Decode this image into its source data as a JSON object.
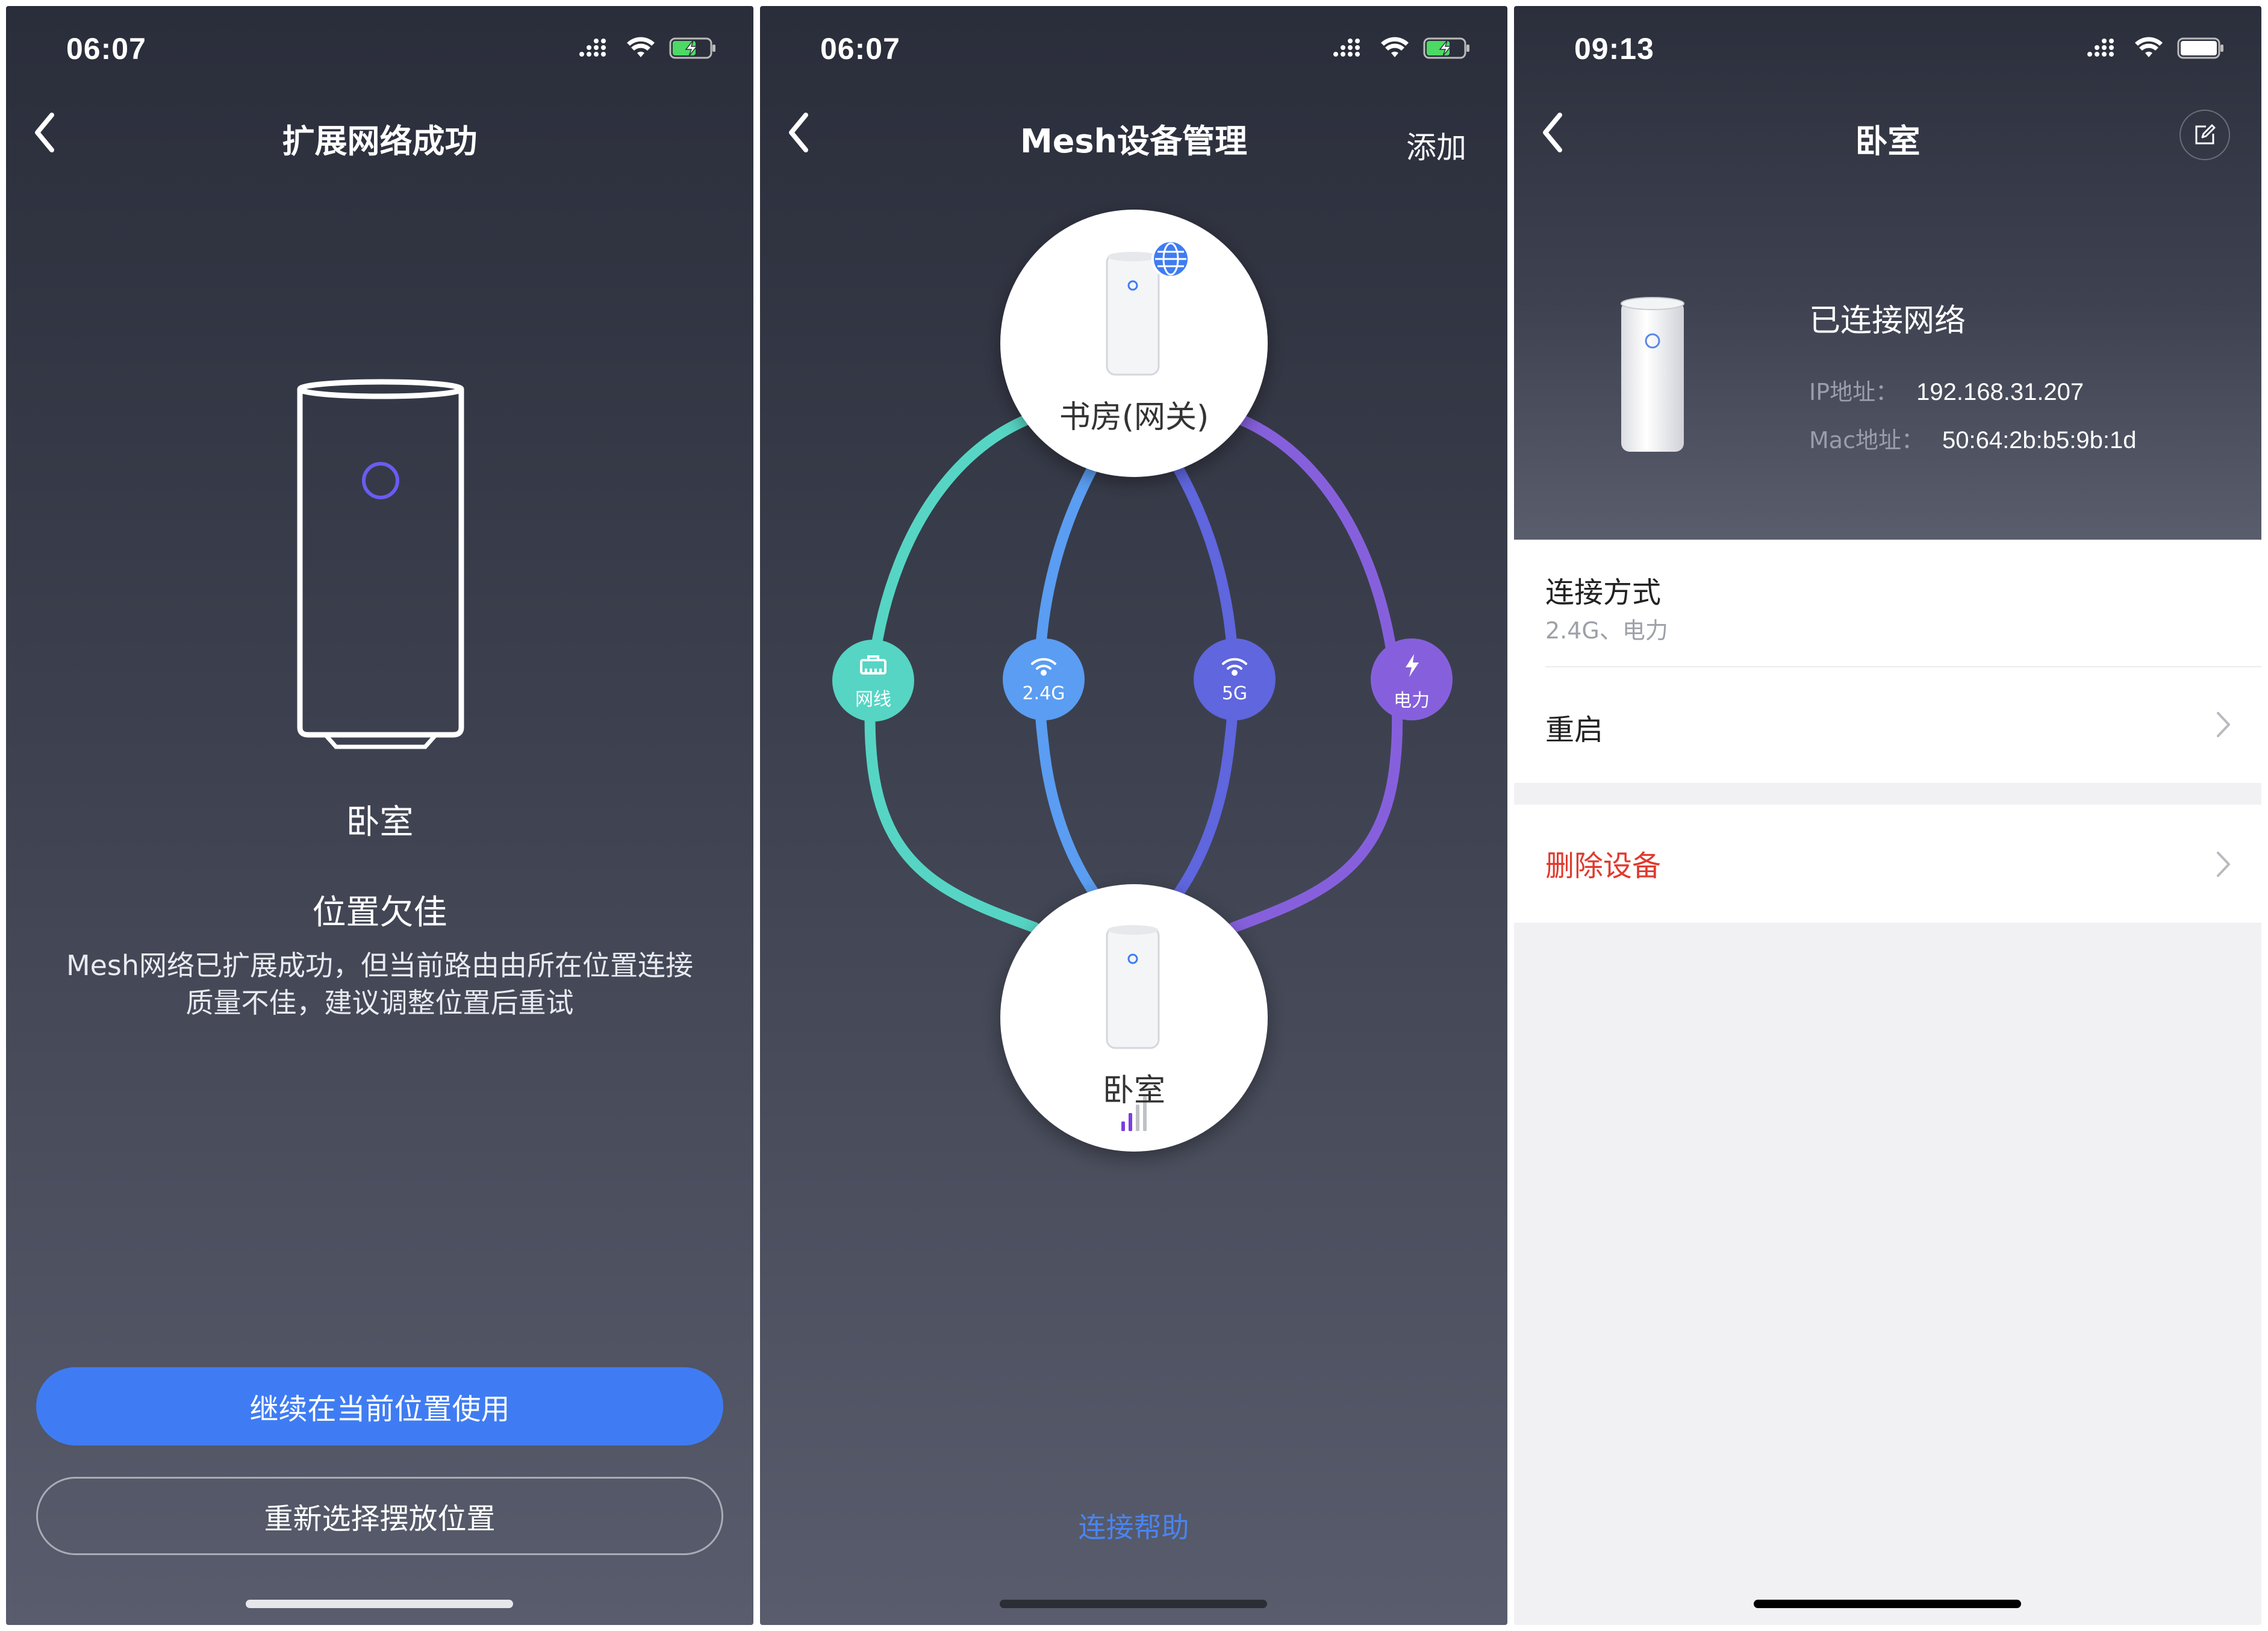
{
  "colors": {
    "primary_blue": "#3f7cf3",
    "ethernet": "#56d5c4",
    "wifi24": "#5a9df2",
    "wifi5": "#5f66de",
    "power": "#8660dc",
    "danger": "#e03a2e",
    "help_link": "#4b84f0"
  },
  "screen1": {
    "status_time": "06:07",
    "title": "扩展网络成功",
    "device_name": "卧室",
    "warning_title": "位置欠佳",
    "description": "Mesh网络已扩展成功，但当前路由由所在位置连接质量不佳，建议调整位置后重试",
    "primary_button": "继续在当前位置使用",
    "secondary_button": "重新选择摆放位置"
  },
  "screen2": {
    "status_time": "06:07",
    "title": "Mesh设备管理",
    "add_label": "添加",
    "gateway_node": "书房(网关)",
    "child_node": "卧室",
    "links": [
      {
        "key": "ethernet",
        "label": "网线",
        "icon": "ethernet-icon"
      },
      {
        "key": "wifi24",
        "label": "2.4G",
        "icon": "wifi-icon"
      },
      {
        "key": "wifi5",
        "label": "5G",
        "icon": "wifi-icon"
      },
      {
        "key": "power",
        "label": "电力",
        "icon": "lightning-icon"
      }
    ],
    "signal_bars_active": 2,
    "signal_bars_total": 4,
    "help_link": "连接帮助"
  },
  "screen3": {
    "status_time": "09:13",
    "title": "卧室",
    "connection_status": "已连接网络",
    "ip_label": "IP地址：",
    "ip_value": "192.168.31.207",
    "mac_label": "Mac地址：",
    "mac_value": "50:64:2b:b5:9b:1d",
    "connection_method_label": "连接方式",
    "connection_method_value": "2.4G、电力",
    "restart_label": "重启",
    "delete_label": "删除设备"
  }
}
